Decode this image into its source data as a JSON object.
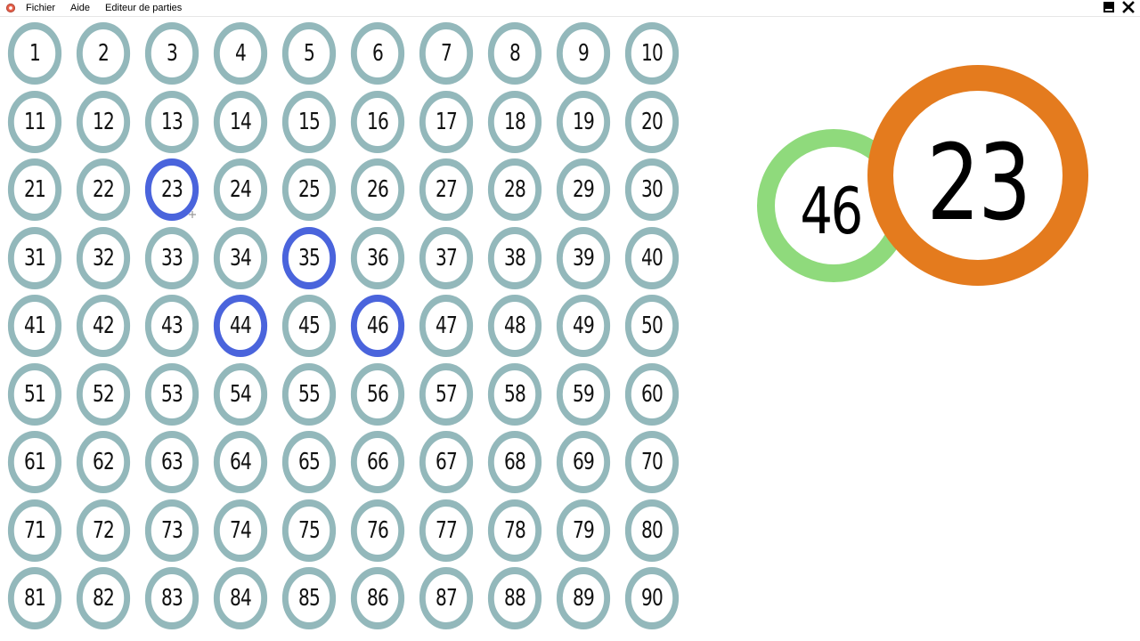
{
  "menu": {
    "items": [
      "Fichier",
      "Aide",
      "Editeur de parties"
    ]
  },
  "board": {
    "numbers": [
      "1",
      "2",
      "3",
      "4",
      "5",
      "6",
      "7",
      "8",
      "9",
      "10",
      "11",
      "12",
      "13",
      "14",
      "15",
      "16",
      "17",
      "18",
      "19",
      "20",
      "21",
      "22",
      "23",
      "24",
      "25",
      "26",
      "27",
      "28",
      "29",
      "30",
      "31",
      "32",
      "33",
      "34",
      "35",
      "36",
      "37",
      "38",
      "39",
      "40",
      "41",
      "42",
      "43",
      "44",
      "45",
      "46",
      "47",
      "48",
      "49",
      "50",
      "51",
      "52",
      "53",
      "54",
      "55",
      "56",
      "57",
      "58",
      "59",
      "60",
      "61",
      "62",
      "63",
      "64",
      "65",
      "66",
      "67",
      "68",
      "69",
      "70",
      "71",
      "72",
      "73",
      "74",
      "75",
      "76",
      "77",
      "78",
      "79",
      "80",
      "81",
      "82",
      "83",
      "84",
      "85",
      "86",
      "87",
      "88",
      "89",
      "90"
    ],
    "called": [
      "23",
      "35",
      "44",
      "46"
    ]
  },
  "current_draw": {
    "number": "23"
  },
  "previous_draw": {
    "number": "46"
  },
  "colors": {
    "ball_ring": "#93b8bb",
    "called_ring": "#4a64dc",
    "current_ring": "#e47b1e",
    "previous_ring": "#8fda7c"
  },
  "icons": {
    "app": "app-logo-icon",
    "minimize": "minimize-icon",
    "close": "close-icon"
  }
}
